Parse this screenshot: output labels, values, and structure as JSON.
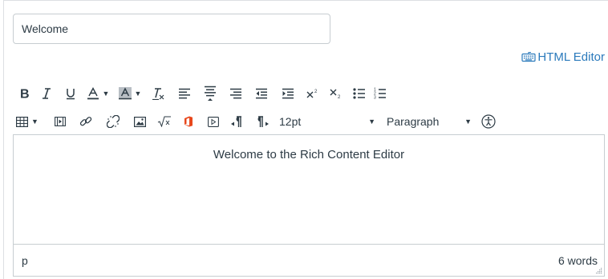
{
  "title_field": {
    "value": "Welcome",
    "placeholder": ""
  },
  "html_editor_link": {
    "label": "HTML Editor",
    "icon": "keyboard-icon"
  },
  "toolbar": {
    "row1": [
      {
        "name": "bold-button",
        "icon": "bold-icon"
      },
      {
        "name": "italic-button",
        "icon": "italic-icon"
      },
      {
        "name": "underline-button",
        "icon": "underline-icon"
      },
      {
        "name": "text-color-button",
        "icon": "text-color-icon"
      },
      {
        "name": "background-color-button",
        "icon": "background-color-icon"
      },
      {
        "name": "clear-formatting-button",
        "icon": "clear-formatting-icon"
      },
      {
        "name": "align-left-button",
        "icon": "align-left-icon"
      },
      {
        "name": "align-center-button",
        "icon": "align-center-icon"
      },
      {
        "name": "align-right-button",
        "icon": "align-right-icon"
      },
      {
        "name": "outdent-button",
        "icon": "outdent-icon"
      },
      {
        "name": "indent-button",
        "icon": "indent-icon"
      },
      {
        "name": "superscript-button",
        "icon": "superscript-icon"
      },
      {
        "name": "subscript-button",
        "icon": "subscript-icon"
      },
      {
        "name": "bullet-list-button",
        "icon": "bullet-list-icon"
      },
      {
        "name": "numbered-list-button",
        "icon": "numbered-list-icon"
      }
    ],
    "font_size": "12pt",
    "block_format": "Paragraph"
  },
  "editor": {
    "content": "Welcome to the Rich Content Editor"
  },
  "statusbar": {
    "path": "p",
    "word_count": "6 words"
  },
  "colors": {
    "link": "#2b7abc",
    "text": "#2d3b45",
    "border": "#c7cdd1",
    "office_icon": "#e8481d"
  }
}
